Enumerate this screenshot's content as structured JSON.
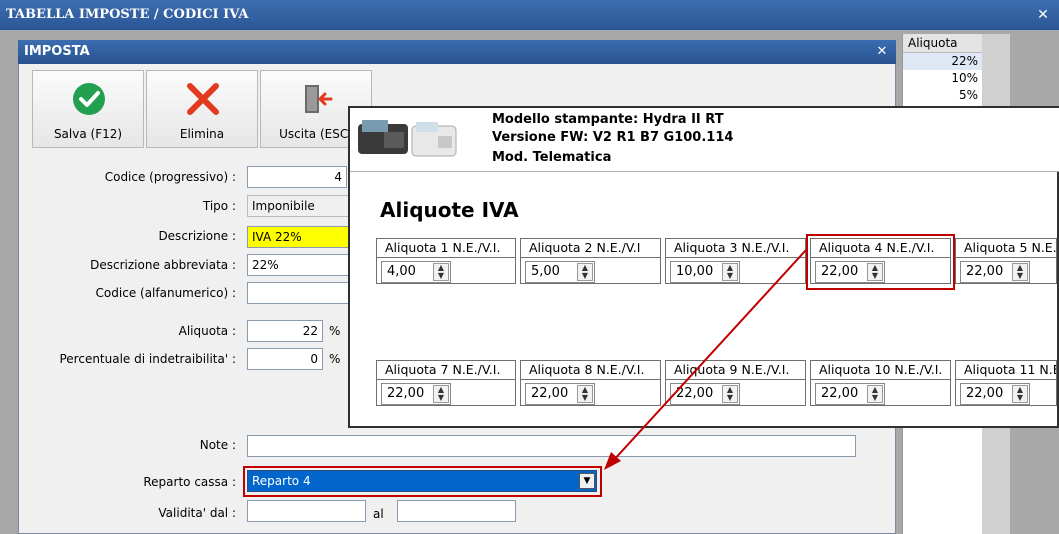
{
  "outer_window": {
    "title": "TABELLA IMPOSTE / CODICI IVA",
    "close_label": "✕"
  },
  "background_grid": {
    "header": "Aliquota",
    "values": [
      "22%",
      "10%",
      "5%"
    ]
  },
  "inner_window": {
    "title": "IMPOSTA",
    "close_label": "✕"
  },
  "toolbar": {
    "save_label": "Salva (F12)",
    "delete_label": "Elimina",
    "exit_label": "Uscita (ESC)"
  },
  "form": {
    "codice_label": "Codice (progressivo) :",
    "codice_value": "4",
    "tipo_label": "Tipo :",
    "tipo_value": "Imponibile",
    "descrizione_label": "Descrizione :",
    "descrizione_value": "IVA 22%",
    "descr_abbr_label": "Descrizione abbreviata :",
    "descr_abbr_value": "22%",
    "codice_alfa_label": "Codice (alfanumerico) :",
    "codice_alfa_value": "",
    "aliquota_label": "Aliquota :",
    "aliquota_value": "22",
    "aliquota_unit": "%",
    "indetraibilita_label": "Percentuale di indetraibilita' :",
    "indetraibilita_value": "0",
    "indetraibilita_unit": "%",
    "note_label": "Note :",
    "note_value": "",
    "reparto_label": "Reparto cassa :",
    "reparto_value": "Reparto 4",
    "validita_label": "Validita' dal :",
    "validita_from": "",
    "validita_al_label": "al",
    "validita_to": ""
  },
  "printer_popup": {
    "model_line": "Modello stampante: Hydra II RT",
    "fw_line": "Versione FW: V2 R1 B7 G100.114",
    "mode_line": "Mod. Telematica",
    "section_title": "Aliquote IVA",
    "row1": [
      {
        "label": "Aliquota 1  N.E./V.I.",
        "value": "4,00"
      },
      {
        "label": "Aliquota 2  N.E./V.I",
        "value": "5,00"
      },
      {
        "label": "Aliquota 3  N.E./V.I.",
        "value": "10,00"
      },
      {
        "label": "Aliquota 4  N.E./V.I.",
        "value": "22,00"
      },
      {
        "label": "Aliquota 5  N.E.",
        "value": "22,00"
      }
    ],
    "row2": [
      {
        "label": "Aliquota 7  N.E./V.I.",
        "value": "22,00"
      },
      {
        "label": "Aliquota 8  N.E./V.I.",
        "value": "22,00"
      },
      {
        "label": "Aliquota 9  N.E./V.I.",
        "value": "22,00"
      },
      {
        "label": "Aliquota 10 N.E./V.I.",
        "value": "22,00"
      },
      {
        "label": "Aliquota 11 N.E",
        "value": "22,00"
      }
    ]
  },
  "colors": {
    "highlight_yellow": "#ffff00",
    "annotation_red": "#c00000",
    "title_blue": "#2a5594",
    "selection_blue": "#0066cc"
  }
}
